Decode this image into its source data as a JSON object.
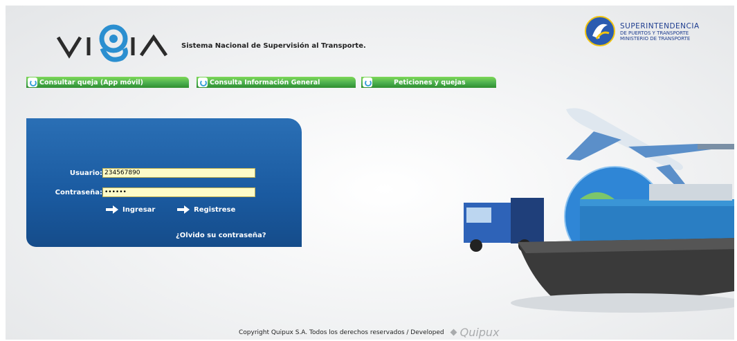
{
  "header": {
    "logo_text": "VIGIA",
    "system_title": "Sistema Nacional de Supervisión al Transporte.",
    "agency": {
      "line1": "SUPERINTENDENCIA",
      "line2": "DE PUERTOS Y TRANSPORTE",
      "line3": "MINISTERIO DE TRANSPORTE"
    }
  },
  "nav": {
    "tabs": [
      {
        "label": "Consultar queja (App móvil)",
        "icon": "refresh-icon"
      },
      {
        "label": "Consulta Información General",
        "icon": "refresh-icon"
      },
      {
        "label": "Peticiones y quejas",
        "icon": "refresh-icon"
      }
    ]
  },
  "login": {
    "user_label": "Usuario:",
    "user_value": "234567890",
    "password_label": "Contraseña:",
    "password_value": "••••••",
    "login_label": "Ingresar",
    "register_label": "Registrese",
    "forgot_label": "¿Olvido su contraseña?"
  },
  "footer": {
    "copyright": "Copyright Quipux S.A. Todos los derechos reservados / Developed",
    "brand": "Quipux"
  },
  "colors": {
    "panel_blue": "#1a5aa0",
    "tab_green": "#4caf50",
    "field_yellow": "#fdfbc8",
    "agency_blue": "#1d3c8f"
  }
}
